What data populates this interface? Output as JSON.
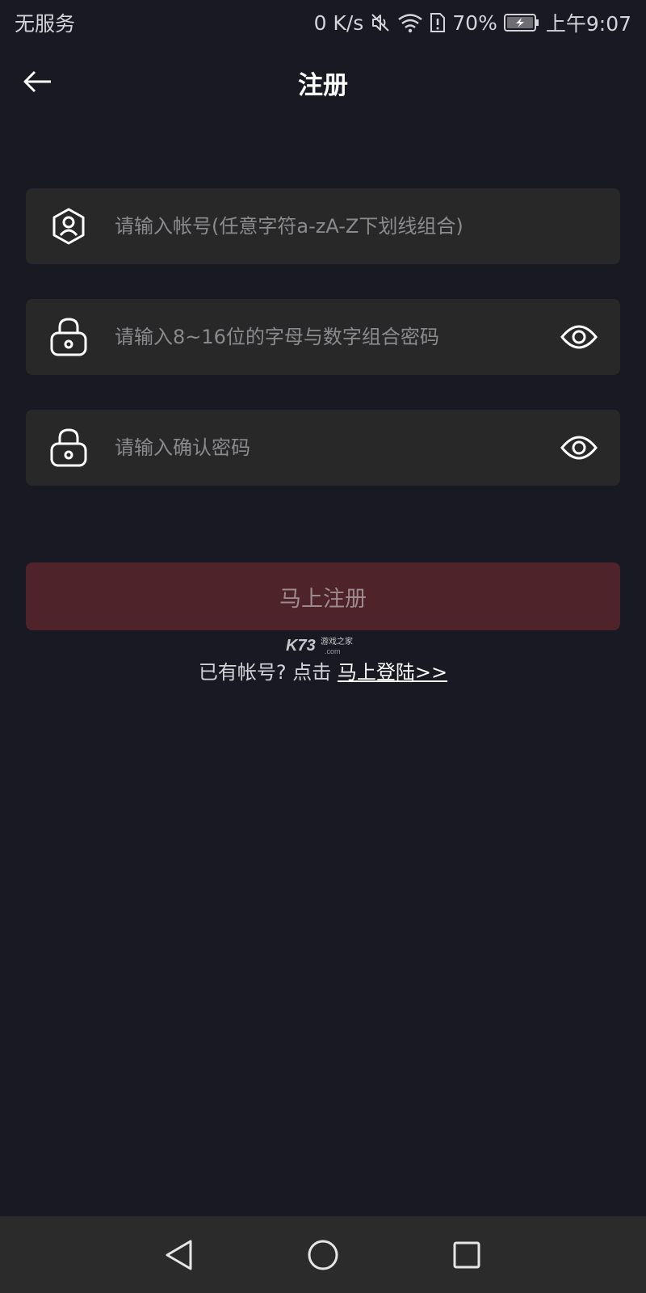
{
  "status_bar": {
    "carrier": "无服务",
    "net_speed": "0 K/s",
    "battery_percent": "70%",
    "time": "上午9:07",
    "icons": [
      "mute-icon",
      "wifi-icon",
      "sim-alert-icon",
      "battery-charging-icon"
    ]
  },
  "header": {
    "title": "注册",
    "back_icon": "arrow-left-icon"
  },
  "form": {
    "account": {
      "value": "",
      "placeholder": "请输入帐号(任意字符a-zA-Z下划线组合)",
      "icon": "user-shield-icon"
    },
    "password": {
      "value": "",
      "placeholder": "请输入8~16位的字母与数字组合密码",
      "icon": "lock-icon",
      "toggle_icon": "eye-icon"
    },
    "confirm_password": {
      "value": "",
      "placeholder": "请输入确认密码",
      "icon": "lock-icon",
      "toggle_icon": "eye-icon"
    }
  },
  "register_button": {
    "label": "马上注册"
  },
  "watermark": {
    "brand": "K73",
    "tagline": "游戏之家",
    "domain": ".com"
  },
  "login_prompt": {
    "text": "已有帐号? 点击 ",
    "link": "马上登陆>>"
  },
  "nav_bar": {
    "icons": [
      "nav-back-icon",
      "nav-home-icon",
      "nav-recents-icon"
    ]
  },
  "colors": {
    "background": "#181923",
    "field_background": "#282828",
    "button_background": "#4e2329",
    "button_text": "#9c8a8e",
    "placeholder": "#8b8b8f",
    "nav_background": "#2b2b2b"
  }
}
